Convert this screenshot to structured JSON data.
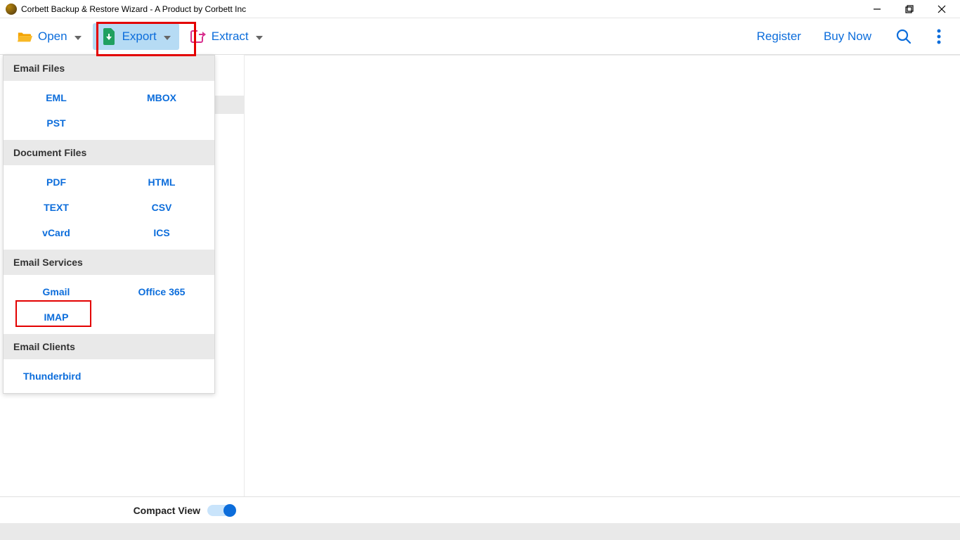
{
  "window": {
    "title": "Corbett Backup & Restore Wizard - A Product by Corbett Inc"
  },
  "toolbar": {
    "open_label": "Open",
    "export_label": "Export",
    "extract_label": "Extract",
    "register_label": "Register",
    "buynow_label": "Buy Now"
  },
  "export_menu": {
    "sections": [
      {
        "title": "Email Files",
        "items": [
          "EML",
          "MBOX",
          "PST"
        ]
      },
      {
        "title": "Document Files",
        "items": [
          "PDF",
          "HTML",
          "TEXT",
          "CSV",
          "vCard",
          "ICS"
        ]
      },
      {
        "title": "Email Services",
        "items": [
          "Gmail",
          "Office 365",
          "IMAP"
        ]
      },
      {
        "title": "Email Clients",
        "items": [
          "Thunderbird"
        ]
      }
    ]
  },
  "bottom": {
    "compact_view_label": "Compact View",
    "compact_view_on": true
  },
  "highlights": {
    "export_button": true,
    "imap_item": true
  },
  "colors": {
    "accent_blue": "#0c6ddb",
    "export_bg": "#b6dbf4",
    "highlight_red": "#e30000",
    "folder_orange": "#f4a300",
    "export_green": "#20a060",
    "extract_pink": "#d8308e"
  }
}
